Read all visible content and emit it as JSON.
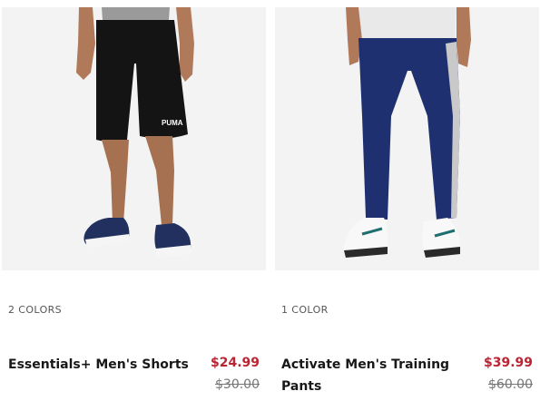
{
  "products": [
    {
      "colors_label": "2 COLORS",
      "name": "Essentials+ Men's Shorts",
      "sale_price": "$24.99",
      "original_price": "$30.00",
      "image_icon": "model-shorts-photo",
      "logo_text": "PUMA"
    },
    {
      "colors_label": "1 COLOR",
      "name": "Activate Men's Training Pants",
      "sale_price": "$39.99",
      "original_price": "$60.00",
      "image_icon": "model-pants-photo"
    }
  ],
  "colors": {
    "sale": "#ba2433",
    "original": "#767676",
    "text": "#181818",
    "image_bg": "#f3f3f3"
  }
}
